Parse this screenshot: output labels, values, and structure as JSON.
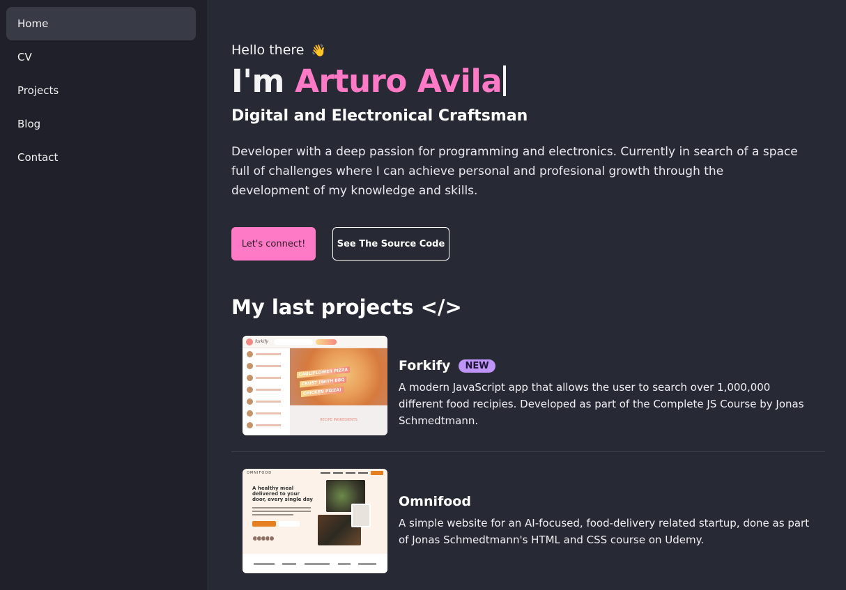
{
  "sidebar": {
    "items": [
      {
        "label": "Home",
        "active": true
      },
      {
        "label": "CV"
      },
      {
        "label": "Projects"
      },
      {
        "label": "Blog"
      },
      {
        "label": "Contact"
      }
    ]
  },
  "hero": {
    "greeting": "Hello there",
    "greeting_emoji": "👋",
    "headline_prefix": "I'm ",
    "name": "Arturo Avila",
    "subtitle": "Digital and Electronical Craftsman",
    "intro": "Developer with a deep passion for programming and electronics. Currently in search of a space full of challenges where I can achieve personal and profesional growth through the development of my knowledge and skills.",
    "primary_button": "Let's connect!",
    "secondary_button": "See The Source Code"
  },
  "projects_section": {
    "title": "My last projects </>",
    "items": [
      {
        "name": "Forkify",
        "badge": "NEW",
        "description": "A modern JavaScript app that allows the user to search over 1,000,000 different food recipies. Developed as part of the Complete JS Course by Jonas Schmedtmann.",
        "thumbnail": {
          "brand": "forkify",
          "tag_lines": [
            "CAULIFLOWER PIZZA",
            "CRUST (WITH BBQ",
            "CHICKEN PIZZA)"
          ],
          "ingredients_title": "RECIPE INGREDIENTS"
        }
      },
      {
        "name": "Omnifood",
        "description": "A simple website for an AI-focused, food-delivery related startup, done as part of Jonas Schmedtmann's HTML and CSS course on Udemy.",
        "thumbnail": {
          "brand": "OMNIFOOD",
          "headline": "A healthy meal delivered to your door, every single day"
        }
      }
    ]
  },
  "colors": {
    "accent": "#ff7ac6",
    "badge": "#bf95f9",
    "background": "#272935",
    "sidebar": "#1f2029"
  }
}
